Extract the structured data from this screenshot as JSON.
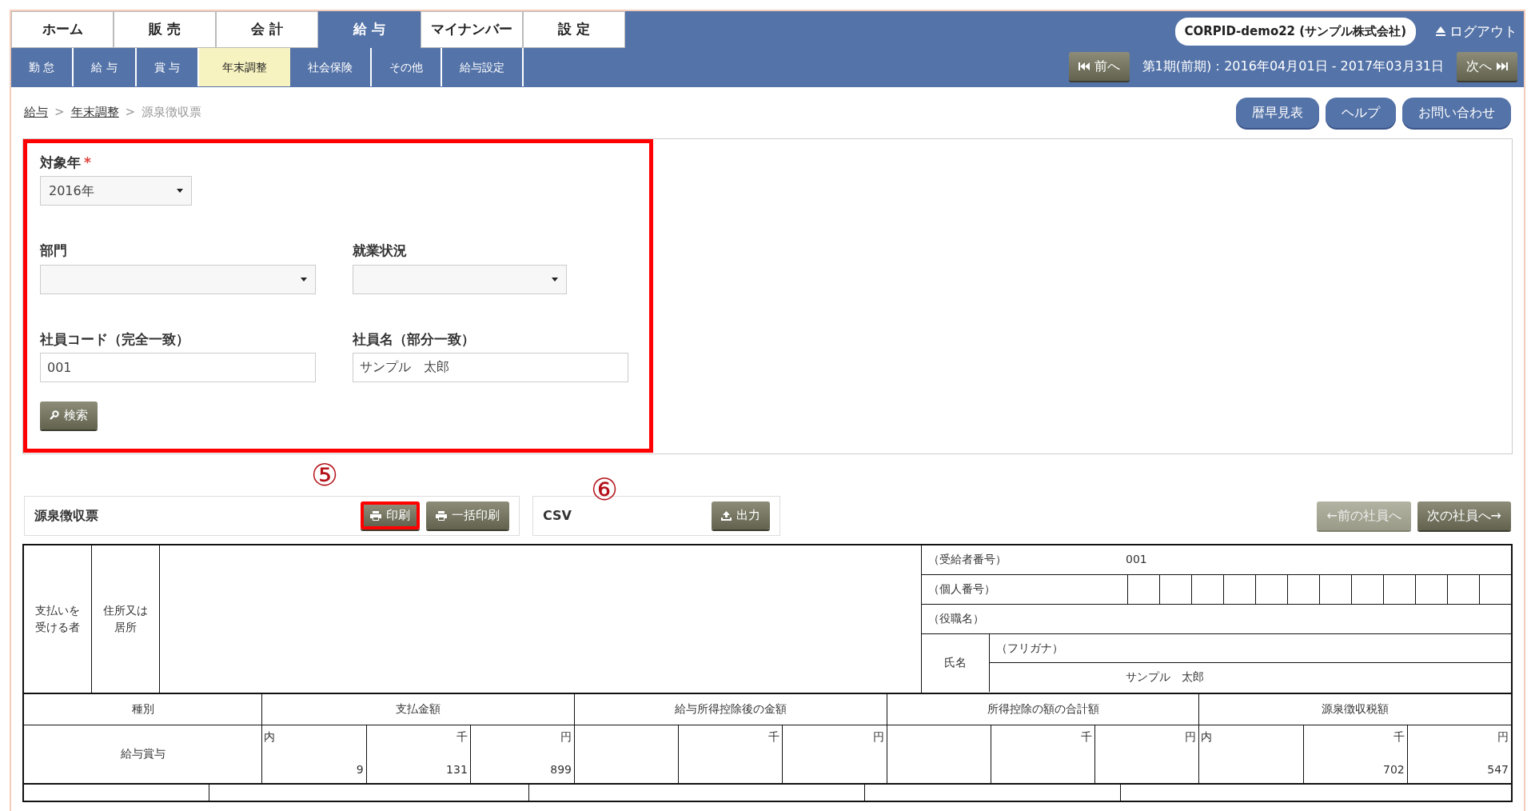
{
  "main_tabs": [
    {
      "label": "ホーム",
      "selected": false
    },
    {
      "label": "販 売",
      "selected": false
    },
    {
      "label": "会 計",
      "selected": false
    },
    {
      "label": "給 与",
      "selected": true
    },
    {
      "label": "マイナンバー",
      "selected": false
    },
    {
      "label": "設 定",
      "selected": false
    }
  ],
  "sub_tabs": [
    {
      "label": "勤 怠",
      "selected": false
    },
    {
      "label": "給 与",
      "selected": false
    },
    {
      "label": "賞 与",
      "selected": false
    },
    {
      "label": "年末調整",
      "selected": true
    },
    {
      "label": "社会保険",
      "selected": false
    },
    {
      "label": "その他",
      "selected": false
    },
    {
      "label": "給与設定",
      "selected": false
    }
  ],
  "company": "CORPID-demo22 (サンプル株式会社)",
  "logout": "ログアウト",
  "period": {
    "prev": "前へ",
    "label": "第1期(前期)：2016年04月01日 - 2017年03月31日",
    "next": "次へ"
  },
  "breadcrumb_separator": ">",
  "breadcrumb": [
    {
      "label": "給与",
      "current": false
    },
    {
      "label": "年末調整",
      "current": false
    },
    {
      "label": "源泉徴収票",
      "current": true
    }
  ],
  "header_buttons": [
    "暦早見表",
    "ヘルプ",
    "お問い合わせ"
  ],
  "filter": {
    "highlighted": true,
    "year": {
      "label": "対象年",
      "required_mark": "*",
      "value": "2016年"
    },
    "department": {
      "label": "部門"
    },
    "status": {
      "label": "就業状況"
    },
    "code": {
      "label": "社員コード（完全一致）",
      "value": "001"
    },
    "name": {
      "label": "社員名（部分一致）",
      "value": "サンプル　太郎"
    },
    "search_button": "検索"
  },
  "slip_panel": {
    "title": "源泉徴収票",
    "buttons": [
      {
        "label": "印刷",
        "highlighted": true,
        "callout": "⑤"
      },
      {
        "label": "一括印刷",
        "highlighted": false
      }
    ]
  },
  "csv_panel": {
    "title": "CSV",
    "callout": "⑥",
    "button": "出力"
  },
  "employee_nav": [
    {
      "label": "←前の社員へ",
      "disabled": true
    },
    {
      "label": "次の社員へ→",
      "disabled": false
    }
  ],
  "slip": {
    "recipient_label": "支払いを受ける者",
    "address_label": "住所又は居所",
    "recipient_no": {
      "label": "（受給者番号）",
      "value": "001"
    },
    "personal_no": {
      "label": "（個人番号）"
    },
    "position": {
      "label": "（役職名）"
    },
    "name": {
      "label": "氏名",
      "furigana_label": "（フリガナ）",
      "value": "サンプル　太郎"
    },
    "columns": [
      "種別",
      "支払金額",
      "給与所得控除後の金額",
      "所得控除の額の合計額",
      "源泉徴収税額"
    ],
    "row": {
      "type": "給与賞与",
      "amounts": [
        {
          "inner": {
            "unit": "内",
            "value": "9"
          },
          "thousands": {
            "unit": "千",
            "value": "131"
          },
          "yen": {
            "unit": "円",
            "value": "899"
          }
        },
        {
          "thousands": {
            "unit": "千"
          },
          "yen": {
            "unit": "円"
          }
        },
        {
          "thousands": {
            "unit": "千"
          },
          "yen": {
            "unit": "円"
          }
        },
        {
          "inner": {
            "unit": "内"
          },
          "thousands": {
            "unit": "千",
            "value": "702"
          },
          "yen": {
            "unit": "円",
            "value": "547"
          }
        }
      ]
    }
  }
}
